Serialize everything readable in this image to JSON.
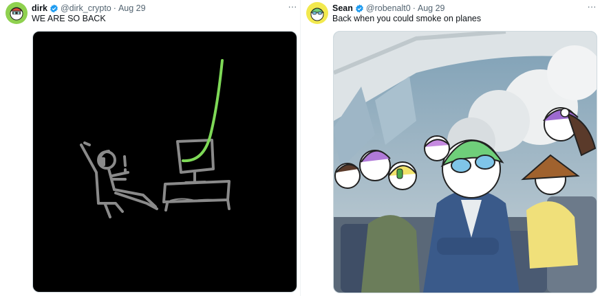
{
  "tweets": [
    {
      "name": "dirk",
      "handle": "@dirk_crypto",
      "separator": "·",
      "date": "Aug 29",
      "text": "WE ARE SO BACK",
      "media": {
        "kind": "drawing",
        "background": "#000000",
        "accent": "#7ed957"
      }
    },
    {
      "name": "Sean",
      "handle": "@robenalt0",
      "separator": "·",
      "date": "Aug 29",
      "text": "Back when you could smoke on planes",
      "media": {
        "kind": "photo-illustration"
      }
    }
  ],
  "icons": {
    "verified": "verified-badge-icon",
    "more": "more-options-icon"
  },
  "colors": {
    "verified": "#1d9bf0",
    "muted": "#536471",
    "text": "#0f1419"
  }
}
